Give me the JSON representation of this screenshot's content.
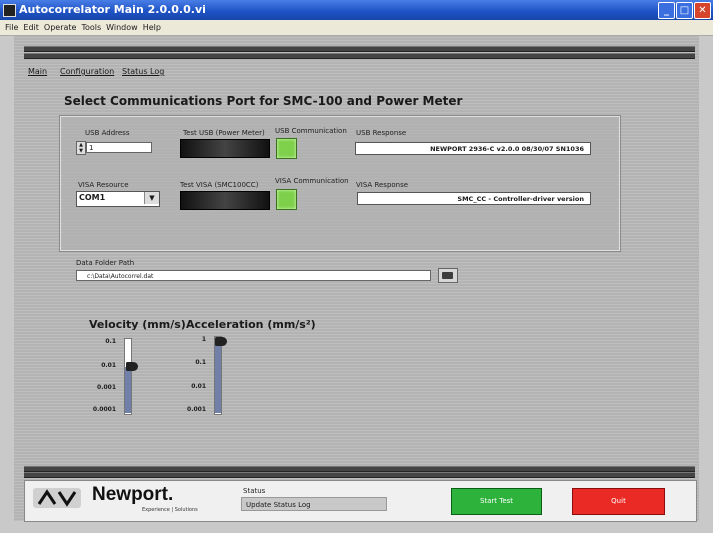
{
  "window": {
    "title": "Autocorrelator Main 2.0.0.0.vi"
  },
  "menu": [
    "File",
    "Edit",
    "Operate",
    "Tools",
    "Window",
    "Help"
  ],
  "tabs": [
    "Main",
    "Configuration",
    "Status Log"
  ],
  "section_title": "Select Communications Port for SMC-100 and Power Meter",
  "usb": {
    "address_label": "USB Address",
    "address_value": "1",
    "test_button_label": "Test USB (Power Meter)",
    "communication_label": "USB Communication",
    "response_label": "USB Response",
    "response_value": "NEWPORT 2936-C v2.0.0 08/30/07 SN1036"
  },
  "visa": {
    "resource_label": "VISA Resource",
    "resource_value": "COM1",
    "test_button_label": "Test VISA (SMC100CC)",
    "communication_label": "VISA Communication",
    "response_label": "VISA Response",
    "response_value": "SMC_CC - Controller-driver version"
  },
  "data_folder": {
    "label": "Data Folder Path",
    "value": "c:\\Data\\Autocorrel.dat"
  },
  "velocity": {
    "title": "Velocity (mm/s)",
    "ticks": [
      "0.1",
      "0.01",
      "0.001",
      "0.0001"
    ],
    "value": 0.01
  },
  "acceleration": {
    "title": "Acceleration (mm/s²)",
    "ticks": [
      "1",
      "0.1",
      "0.01",
      "0.001"
    ],
    "value": 1
  },
  "footer": {
    "logo_text": "Newport.",
    "logo_tagline": "Experience | Solutions",
    "status_label": "Status",
    "status_value": "Update Status Log",
    "start_button": "Start Test",
    "quit_button": "Quit"
  },
  "colors": {
    "led_on": "#7ed04a",
    "start": "#2db33c",
    "quit": "#ea2a25",
    "titlebar": "#1f54c7"
  }
}
